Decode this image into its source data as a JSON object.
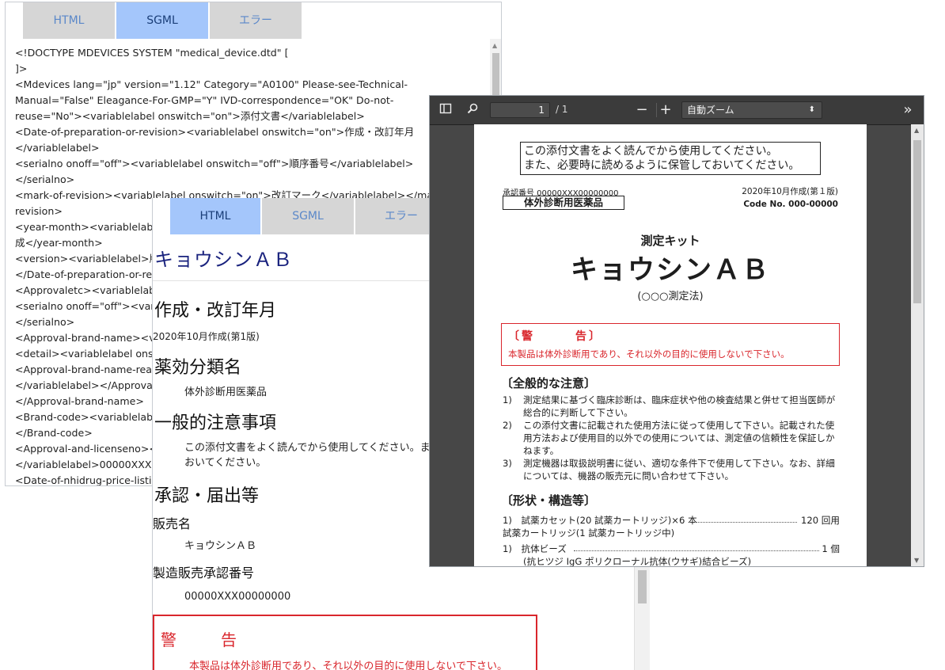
{
  "tabs": {
    "html": "HTML",
    "sgml": "SGML",
    "error": "エラー"
  },
  "sgml_window": {
    "lines": [
      "<!DOCTYPE MDEVICES SYSTEM \"medical_device.dtd\" [",
      "]>",
      "<Mdevices lang=\"jp\" version=\"1.12\" Category=\"A0100\" Please-see-Technical-",
      "Manual=\"False\" Eleagance-For-GMP=\"Y\" IVD-correspondence=\"OK\" Do-not-",
      "reuse=\"No\"><variablelabel onswitch=\"on\">添付文書</variablelabel>",
      "<Date-of-preparation-or-revision><variablelabel onswitch=\"on\">作成・改訂年月",
      "</variablelabel>",
      "<serialno onoff=\"off\"><variablelabel onswitch=\"off\">順序番号</variablelabel>",
      "</serialno>",
      "<mark-of-revision><variablelabel onswitch=\"on\">改訂マーク</variablelabel></mark-of-",
      "revision>",
      "<year-month><variablelabel onswitch=\"on\">年月</variablelabel>2020年10月作",
      "成</year-month>",
      "<version><variablelabel>版</variablelabel></version>",
      "</Date-of-preparation-or-revision>",
      "<Approvaletc><variablelabel onswitch=\"on\">承認・届出等</variablelabel>",
      "<serialno onoff=\"off\"><variablelabel onswitch=\"off\">順序番号</variablelabel>",
      "</serialno>",
      "<Approval-brand-name><variablelabel onswitch=\"on\">販売名</variablelabel>",
      "<detail><variablelabel onswitch=\"on\">キョウシンＡＢ</variablelabel></detail>",
      "<Approval-brand-name-reading><variablelabel onswitch=\"off\">販売名読み",
      "</variablelabel></Approval-brand-name-reading>",
      "</Approval-brand-name>",
      "<Brand-code><variablelabel onswitch=\"off\">ブランドコード</variablelabel>",
      "</Brand-code>",
      "<Approval-and-licenseno><variablelabel onswitch=\"on\">製造販売承認番号",
      "</variablelabel>00000XXX00000000</Approval-and-licenseno>",
      "<Date-of-nhidrug-price-listing><variablelabel onswitch=\"off\">"
    ]
  },
  "html_window": {
    "title": "キョウシンＡＢ",
    "sec1_heading": "作成・改訂年月",
    "sec1_text": "2020年10月作成(第1版)",
    "sec2_heading": "薬効分類名",
    "sec2_text": "体外診断用医薬品",
    "sec3_heading": "一般的注意事項",
    "sec3_line1": "この添付文書をよく読んでから使用してください。また、必要時に読めるように保管して",
    "sec3_line2": "おいてください。",
    "sec4_heading": "承認・届出等",
    "brand_label": "販売名",
    "brand_value": "キョウシンＡＢ",
    "approval_label": "製造販売承認番号",
    "approval_value": "00000XXX00000000",
    "warning_title": "警告",
    "warning_text": "本製品は体外診断用であり、それ以外の目的に使用しないで下さい。"
  },
  "pdf_viewer": {
    "page_current": "1",
    "page_total": "/ 1",
    "zoom": "自動ズーム",
    "icons": {
      "sidebar": "sidebar-toggle-icon",
      "search": "search-icon",
      "zoom_out": "minus-icon",
      "zoom_in": "plus-icon",
      "more": "double-chevron-right-icon"
    },
    "page": {
      "notice_line1": "この添付文書をよく読んでから使用してください。",
      "notice_line2": "また、必要時に読めるように保管しておいてください。",
      "approval_no": "承認番号 00000XXX00000000",
      "date": "2020年10月作成(第１版)",
      "category": "体外診断用医薬品",
      "code": "Code No. 000-00000",
      "kit": "測定キット",
      "name": "キョウシンＡＢ",
      "method": "(○○○測定法)",
      "warning_title": "〔警　　　告〕",
      "warning_text": "本製品は体外診断用であり、それ以外の目的に使用しないで下さい。",
      "general_heading": "〔全般的な注意〕",
      "general_items": [
        {
          "n": "1)",
          "t": "測定結果に基づく臨床診断は、臨床症状や他の検査結果と併せて担当医師が総合的に判断して下さい。"
        },
        {
          "n": "2)",
          "t": "この添付文書に記載された使用方法に従って使用して下さい。記載された使用方法および使用目的以外での使用については、測定値の信頼性を保証しかねます。"
        },
        {
          "n": "3)",
          "t": "測定機器は取扱説明書に従い、適切な条件下で使用して下さい。なお、詳細については、機器の販売元に問い合わせて下さい。"
        }
      ],
      "shape_heading": "〔形状・構造等〕",
      "shape_row1_left": "1)　試薬カセット(20 試薬カートリッジ)×6 本",
      "shape_row1_right": "120 回用",
      "shape_sub": "試薬カートリッジ(1 試薬カートリッジ中)",
      "shape_row2_left": "1)　抗体ビーズ",
      "shape_row2_right": "1 個",
      "shape_row2_sub": "(抗ヒツジ IgG ポリクローナル抗体(ウサギ)結合ビーズ)"
    }
  },
  "colors": {
    "tab_active": "#a4c6fb",
    "tab_inactive": "#d6d6d6",
    "warning_red": "#d9262c",
    "title_navy": "#1a237e",
    "pdf_toolbar": "#3b3b3b"
  }
}
